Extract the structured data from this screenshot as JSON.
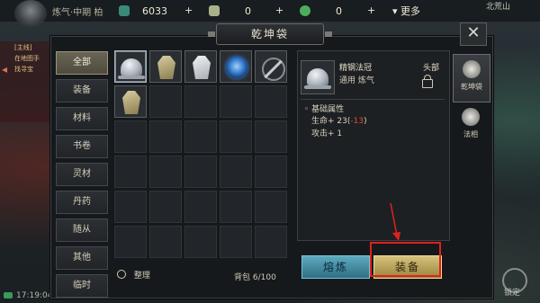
{
  "hud": {
    "realm": "炼气·中期",
    "realm_extra": "柏",
    "resource_1": "6033",
    "resource_2": "0",
    "resource_3": "0",
    "more_label": "更多",
    "clock": "17:19:04",
    "top_right_map": "北荒山",
    "bottom_right_label": "锁定",
    "side_notes": [
      "[主线]",
      "在地图手",
      "找寻宝"
    ]
  },
  "window": {
    "title": "乾坤袋",
    "close_icon": "close-icon"
  },
  "categories": [
    "全部",
    "装备",
    "材料",
    "书卷",
    "灵材",
    "丹药",
    "随从",
    "其他",
    "临时"
  ],
  "selected_category": 0,
  "inventory": {
    "items": [
      {
        "icon": "helmet-icon",
        "selected": true
      },
      {
        "icon": "robe-tan-icon",
        "selected": false
      },
      {
        "icon": "robe-white-icon",
        "selected": false
      },
      {
        "icon": "blue-orb-icon",
        "selected": false
      },
      {
        "icon": "sword-ring-icon",
        "selected": false
      },
      {
        "icon": "robe-tan-icon",
        "selected": false
      }
    ],
    "total_cells": 30,
    "sort_label": "整理",
    "bag_count": "背包 6/100"
  },
  "detail": {
    "name": "精钢法冠",
    "type": "通用 炼气",
    "slot": "头部",
    "section": "基础属性",
    "stat_1_prefix": "生命+ 23(",
    "stat_1_delta": "-13",
    "stat_1_suffix": ")",
    "stat_2": "攻击+ 1"
  },
  "actions": {
    "smelt": "熔炼",
    "equip": "装备"
  },
  "right_tabs": [
    "乾坤袋",
    "法相"
  ],
  "colors": {
    "highlight": "#e0211b",
    "equip_button": "#c8b06a",
    "smelt_button": "#4a90a8",
    "negative_stat": "#e24a3a"
  }
}
